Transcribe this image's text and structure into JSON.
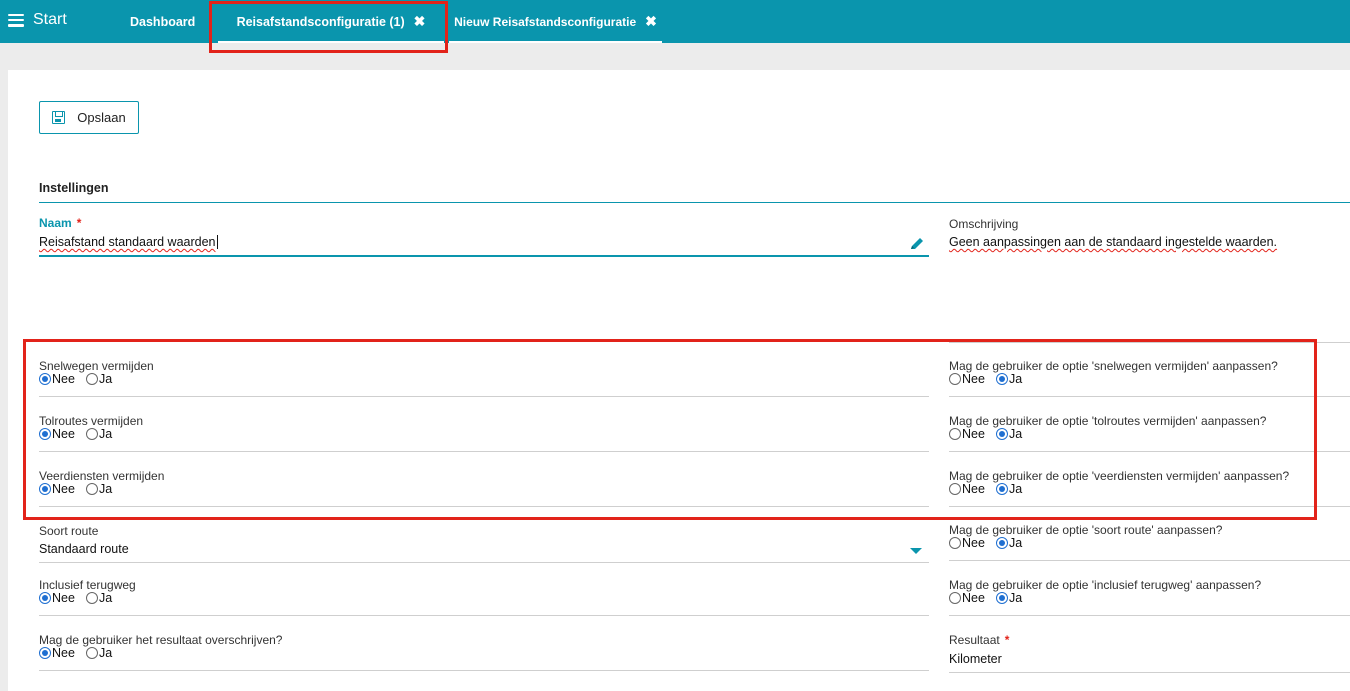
{
  "topbar": {
    "start_label": "Start",
    "tabs": [
      {
        "label": "Dashboard",
        "closable": false
      },
      {
        "label": "Reisafstandsconfiguratie (1)",
        "closable": true
      },
      {
        "label": "Nieuw Reisafstandsconfiguratie",
        "closable": true
      }
    ],
    "close_glyph": "✖"
  },
  "toolbar": {
    "save_label": "Opslaan"
  },
  "section": {
    "title": "Instellingen"
  },
  "fields": {
    "naam": {
      "label": "Naam",
      "required_mark": "*",
      "value": "Reisafstand standaard waarden"
    },
    "omschrijving": {
      "label": "Omschrijving",
      "value": "Geen aanpassingen aan de standaard ingestelde waarden."
    },
    "soort_route": {
      "label": "Soort route",
      "value": "Standaard route"
    },
    "resultaat": {
      "label": "Resultaat",
      "required_mark": "*",
      "value": "Kilometer"
    }
  },
  "radio_labels": {
    "nee": "Nee",
    "ja": "Ja"
  },
  "left_radios": [
    {
      "label": "Snelwegen vermijden",
      "selected": "Nee"
    },
    {
      "label": "Tolroutes vermijden",
      "selected": "Nee"
    },
    {
      "label": "Veerdiensten vermijden",
      "selected": "Nee"
    },
    {
      "label": "Inclusief terugweg",
      "selected": "Nee"
    },
    {
      "label": "Mag de gebruiker het resultaat overschrijven?",
      "selected": "Nee"
    }
  ],
  "right_radios": [
    {
      "label": "Mag de gebruiker de optie 'snelwegen vermijden' aanpassen?",
      "selected": "Ja"
    },
    {
      "label": "Mag de gebruiker de optie 'tolroutes vermijden' aanpassen?",
      "selected": "Ja"
    },
    {
      "label": "Mag de gebruiker de optie 'veerdiensten vermijden' aanpassen?",
      "selected": "Ja"
    },
    {
      "label": "Mag de gebruiker de optie 'soort route' aanpassen?",
      "selected": "Ja"
    },
    {
      "label": "Mag de gebruiker de optie 'inclusief terugweg' aanpassen?",
      "selected": "Ja"
    }
  ],
  "colors": {
    "accent": "#0a95ad",
    "highlight": "#e2231a",
    "radio_checked": "#1f6fd1"
  }
}
